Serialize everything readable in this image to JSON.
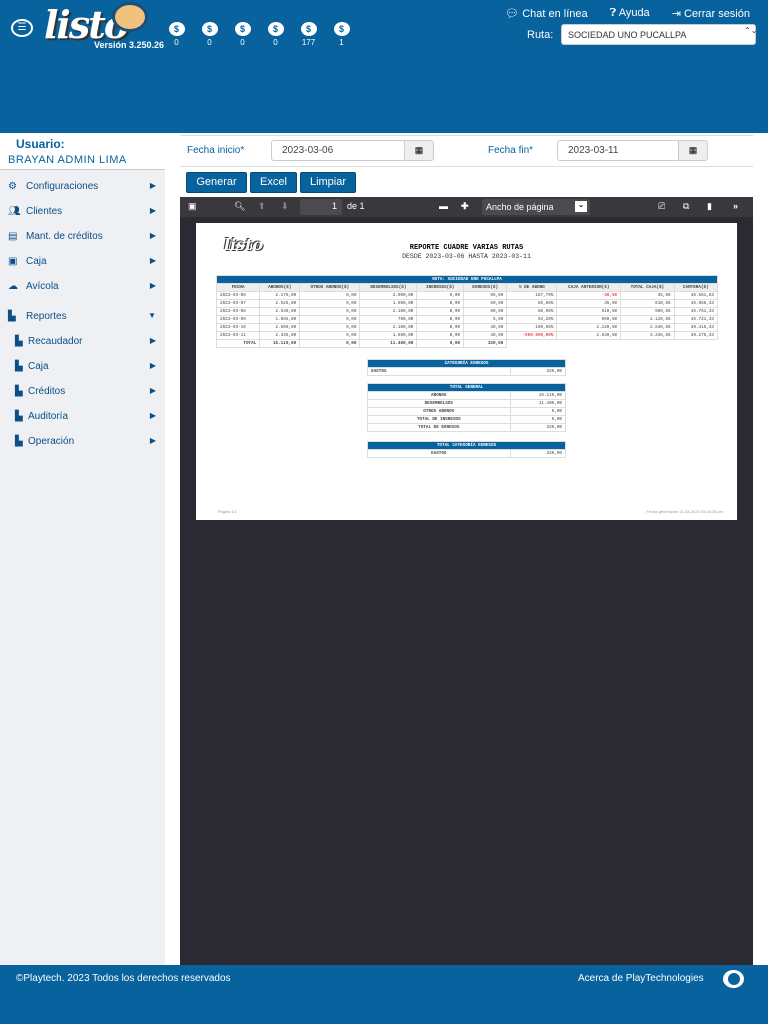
{
  "header": {
    "logo": "listo",
    "version": "Versión 3.250.26",
    "counters": [
      {
        "icon": "invoice-icon",
        "value": "0"
      },
      {
        "icon": "wallet-icon",
        "value": "0"
      },
      {
        "icon": "document-icon",
        "value": "0"
      },
      {
        "icon": "hand-money-icon",
        "value": "0"
      },
      {
        "icon": "cash-icon",
        "value": "177"
      },
      {
        "icon": "refresh-money-icon",
        "value": "1"
      }
    ],
    "links": [
      {
        "icon": "chat-icon",
        "label": "Chat en línea"
      },
      {
        "icon": "help-icon",
        "label": "Ayuda"
      },
      {
        "icon": "logout-icon",
        "label": "Cerrar sesión"
      }
    ],
    "ruta_label": "Ruta:",
    "ruta_value": "SOCIEDAD UNO PUCALLPA"
  },
  "sidebar": {
    "user_label": "Usuario:",
    "user_name": "BRAYAN ADMIN LIMA",
    "items": [
      {
        "label": "Configuraciones",
        "icon": "gears-icon"
      },
      {
        "label": "Clientes",
        "icon": "users-icon"
      },
      {
        "label": "Mant. de créditos",
        "icon": "id-card-icon"
      },
      {
        "label": "Caja",
        "icon": "money-icon"
      },
      {
        "label": "Avícola",
        "icon": "cloud-icon"
      },
      {
        "label": "Reportes",
        "icon": "file-icon"
      }
    ],
    "subitems": [
      {
        "label": "Recaudador"
      },
      {
        "label": "Caja"
      },
      {
        "label": "Créditos"
      },
      {
        "label": "Auditoría"
      },
      {
        "label": "Operación"
      }
    ]
  },
  "filters": {
    "start_label": "Fecha inicio*",
    "start": "2023-03-06",
    "end_label": "Fecha fin*",
    "end": "2023-03-11"
  },
  "buttons": {
    "generate": "Generar",
    "excel": "Excel",
    "clear": "Limpiar"
  },
  "viewer": {
    "page": "1",
    "of": "de 1",
    "zoom": "Ancho de página"
  },
  "report": {
    "title": "REPORTE CUADRE VARIAS RUTAS",
    "subtitle": "DESDE 2023-03-06 HASTA 2023-03-11",
    "route": "RUTA: SOCIEDAD UNO PUCALLPA",
    "columns": [
      "FECHA",
      "ABONOS($)",
      "OTROS ABONOS($)",
      "DESEMBOLSOS($)",
      "INGRESOS($)",
      "EGRESOS($)",
      "% DE ABONO",
      "CAJA ANTERIOR($)",
      "TOTAL CAJA($)",
      "CARTERA($)"
    ],
    "rows": [
      [
        "2023-03-06",
        "2.175,00",
        "0,00",
        "2.000,00",
        "0,00",
        "95,00",
        "187,79%",
        "-46,50",
        "35,50",
        "46.561,83"
      ],
      [
        "2023-03-07",
        "2.525,00",
        "0,00",
        "1.900,00",
        "0,00",
        "50,00",
        "85,86%",
        "35,50",
        "610,50",
        "46.986,33"
      ],
      [
        "2023-03-08",
        "2.540,00",
        "0,00",
        "2.100,00",
        "0,00",
        "90,00",
        "86,96%",
        "610,50",
        "960,50",
        "46.761,33"
      ],
      [
        "2023-03-09",
        "1.865,00",
        "0,00",
        "700,00",
        "0,00",
        "5,00",
        "63,20%",
        "960,50",
        "2.120,50",
        "46.721,33"
      ],
      [
        "2023-03-10",
        "2.660,00",
        "0,00",
        "2.100,00",
        "0,00",
        "40,00",
        "109,65%",
        "2.120,50",
        "2.640,50",
        "39.415,33"
      ],
      [
        "2023-03-11",
        "2.345,00",
        "0,00",
        "1.600,00",
        "0,00",
        "40,00",
        "-999.999,00%",
        "2.640,50",
        "3.345,50",
        "39.275,33"
      ]
    ],
    "total": [
      "TOTAL",
      "15.110,00",
      "0,00",
      "11.400,00",
      "0,00",
      "320,00"
    ],
    "cat_title": "CATEGORÍA EGRESOS",
    "cat_rows": [
      [
        "GASTOS",
        "320,00"
      ]
    ],
    "gen_title": "TOTAL GENERAL",
    "gen_rows": [
      [
        "ABONOS",
        "15.110,00"
      ],
      [
        "DESEMBOLSOS",
        "11.400,00"
      ],
      [
        "OTROS ABONOS",
        "0,00"
      ],
      [
        "TOTAL DE INGRESOS",
        "0,00"
      ],
      [
        "TOTAL DE EGRESOS",
        "320,00"
      ]
    ],
    "tcat_title": "TOTAL CATEGORÍA EGRESOS",
    "tcat_rows": [
      [
        "GASTOS",
        "320,00"
      ]
    ],
    "page_footer": "Página 1/1",
    "gen_date": "Fecha generación 11-03-2023 04:28:28 pm"
  },
  "footer": {
    "copyright": "©Playtech. 2023 Todos los derechos reservados",
    "about": "Acerca de PlayTechnologies"
  }
}
